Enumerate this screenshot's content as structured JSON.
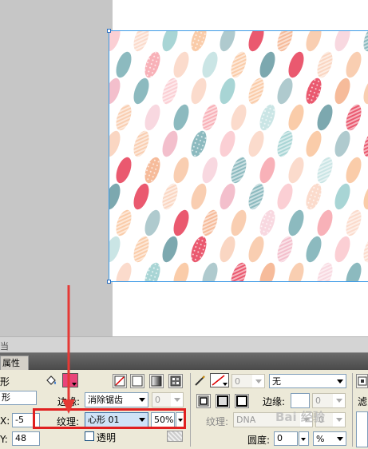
{
  "stage": {
    "top_left_label": "当"
  },
  "panel_tabs": {
    "properties": "属性"
  },
  "left_column": {
    "shape_label_1": "形",
    "shape_label_2": "形",
    "x_label": "X:",
    "x_value": "-5",
    "y_label": "Y:",
    "y_value": "48"
  },
  "fill": {
    "edge_label": "边缘:",
    "edge_value": "消除锯齿",
    "edge_amount": "0",
    "texture_label": "纹理:",
    "texture_value": "心形 01",
    "texture_amount": "50%",
    "transparent_label": "透明",
    "transparent_checked": false
  },
  "stroke": {
    "size_value": "0",
    "style_value": "无",
    "edge_label": "边缘:",
    "edge_amount": "0",
    "texture_label": "纹理:",
    "texture_value": "DNA",
    "texture_amount": "0",
    "roundness_label": "圆度:",
    "roundness_value": "0",
    "roundness_unit": "%"
  },
  "right_edge": {
    "filter_label": "滤"
  },
  "watermark": {
    "text": "Bai 经验"
  },
  "colors": {
    "highlight_box": "#e02020",
    "arrow": "#e53935",
    "selection": "#3d9ae6",
    "fill_swatch": "#e8447a"
  }
}
